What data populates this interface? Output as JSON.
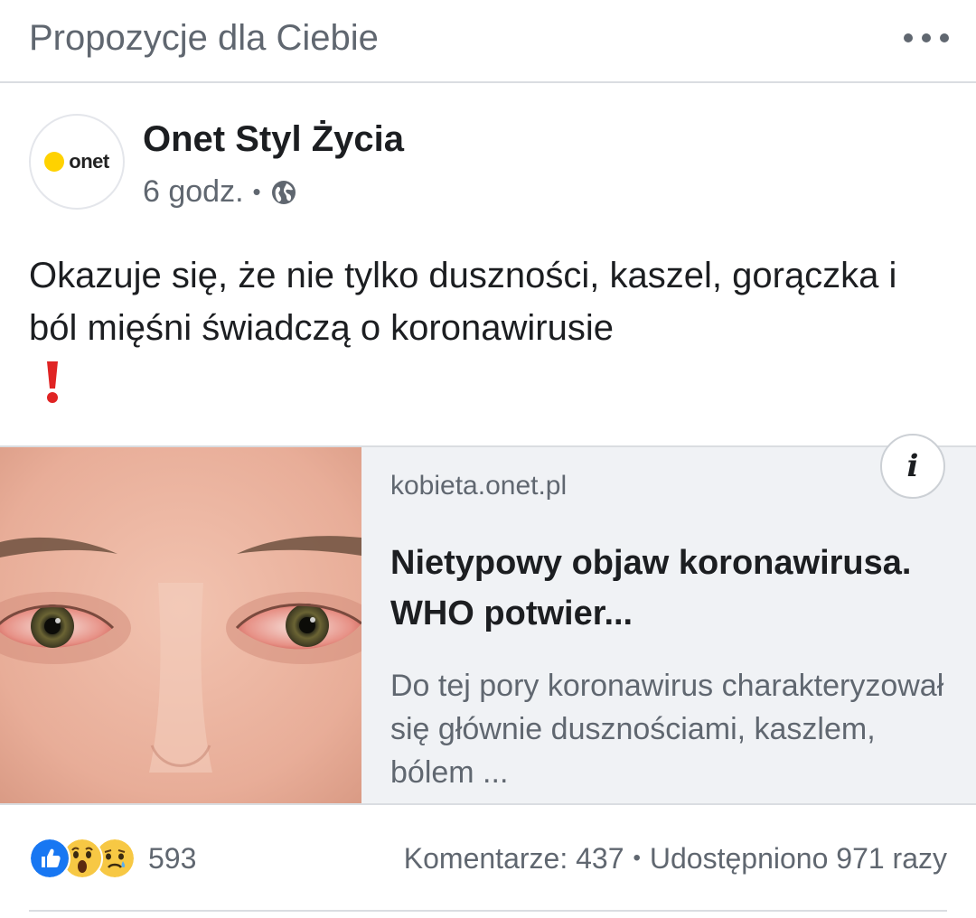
{
  "header": {
    "title": "Propozycje dla Ciebie"
  },
  "post": {
    "page_name": "Onet Styl Życia",
    "avatar_logo": "onet",
    "time": "6 godz.",
    "separator": "•",
    "privacy_icon": "globe-icon",
    "text": "Okazuje się, że nie tylko duszności, kaszel, gorączka i ból mięśni świadczą o koronawirusie",
    "emoji": "exclamation-mark-icon"
  },
  "link_card": {
    "domain": "kobieta.onet.pl",
    "title": "Nietypowy objaw koronawirusa. WHO potwier...",
    "description": "Do tej pory koronawirus charakteryzował się głównie dusznościami, kaszlem, bólem ...",
    "info_label": "i",
    "image": "photo-of-red-irritated-eyes"
  },
  "stats": {
    "reaction_icons": [
      "like-icon",
      "wow-icon",
      "sad-icon"
    ],
    "reaction_count": "593",
    "comments": "Komentarze: 437",
    "bullet": "•",
    "shares": "Udostępniono 971 razy"
  },
  "colors": {
    "accent_blue": "#1877f2",
    "secondary_text": "#606770",
    "card_bg": "#f0f2f5",
    "onet_yellow": "#ffd200",
    "emoji_red": "#e02424"
  }
}
